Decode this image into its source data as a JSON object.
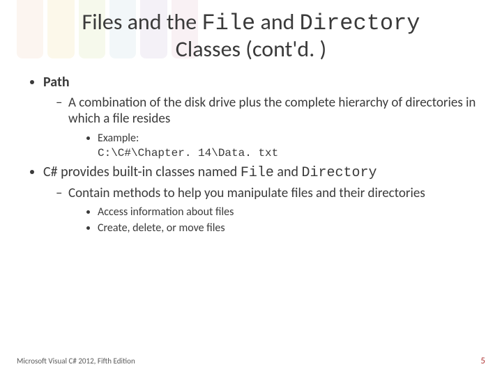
{
  "colors": {
    "stripe1": "#f6d8c5",
    "stripe2": "#f7e4b0",
    "stripe3": "#dce9b6",
    "stripe4": "#cfe3e9",
    "stripe5": "#d7cbe3",
    "stripe6": "#e8c9d5",
    "pageNumber": "#b23a3a"
  },
  "title": {
    "pre": "Files and the ",
    "code1": "File",
    "mid": " and ",
    "code2": "Directory",
    "post": " Classes (cont'd. )"
  },
  "bullets": {
    "b1": {
      "label": "Path"
    },
    "b1_1": "A combination of the disk drive plus the complete hierarchy of directories in which a file resides",
    "b1_1_1_label": "Example:",
    "b1_1_1_code": "C:\\C#\\Chapter. 14\\Data. txt",
    "b2_pre": "C# provides built-in classes named ",
    "b2_code1": "File",
    "b2_mid": " and ",
    "b2_code2": "Directory",
    "b2_1": "Contain methods to help you manipulate files and their directories",
    "b2_1_1": "Access information about files",
    "b2_1_2": "Create, delete, or move files"
  },
  "footer": {
    "source": "Microsoft Visual C# 2012, Fifth Edition",
    "page": "5"
  }
}
